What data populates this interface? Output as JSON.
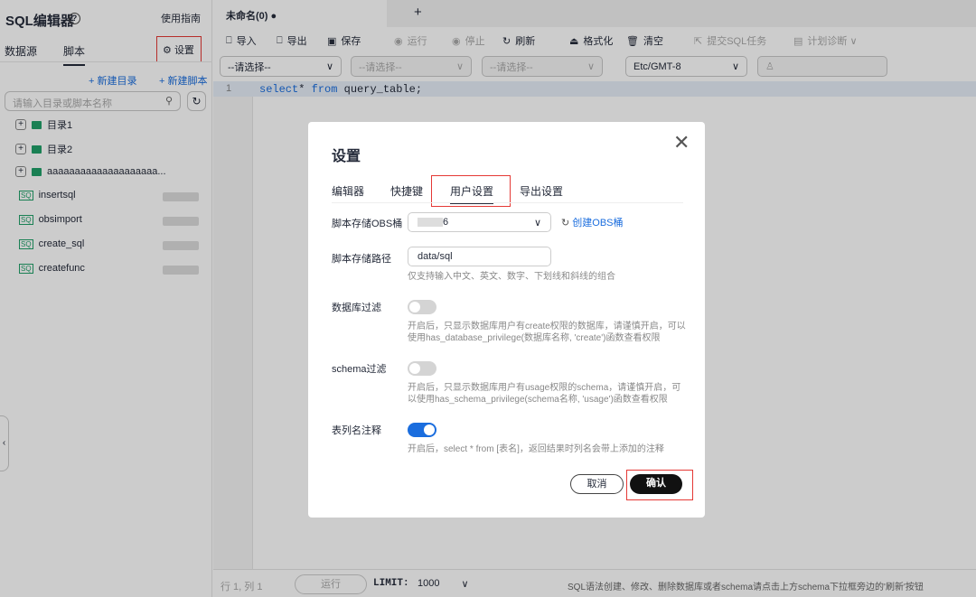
{
  "sidebar": {
    "title": "SQL编辑器",
    "guide": "使用指南",
    "tabs": [
      "数据源",
      "脚本"
    ],
    "settings": "设置",
    "new_dir": "+ 新建目录",
    "new_script": "+ 新建脚本",
    "search_placeholder": "请输入目录或脚本名称",
    "folders": [
      "目录1",
      "目录2",
      "aaaaaaaaaaaaaaaaaaaa..."
    ],
    "scripts": [
      "insertsql",
      "obsimport",
      "create_sql",
      "createfunc"
    ]
  },
  "editor": {
    "tab": "未命名(0) ●",
    "add": "+",
    "toolbar": [
      "导入",
      "导出",
      "保存",
      "运行",
      "停止",
      "刷新",
      "格式化",
      "清空",
      "提交SQL任务",
      "计划诊断 ∨"
    ],
    "selects": [
      "--请选择--",
      "--请选择--",
      "--请选择--",
      "Etc/GMT-8"
    ],
    "line": "1",
    "code_kw1": "select",
    "code_mid": "* ",
    "code_kw2": "from",
    "code_rest": " query_table;"
  },
  "status": {
    "pos": "行 1, 列 1",
    "run": "运行",
    "limit_label": "LIMIT:",
    "limit": "1000",
    "hint": "SQL语法创建、修改、删除数据库或者schema请点击上方schema下拉框旁边的'刷新'按钮"
  },
  "dialog": {
    "title": "设置",
    "tabs": [
      "编辑器",
      "快捷键",
      "用户设置",
      "导出设置"
    ],
    "active_tab": "用户设置",
    "obs_label": "脚本存储OBS桶",
    "obs_value": "6",
    "create_obs": "创建OBS桶",
    "path_label": "脚本存储路径",
    "path_value": "data/sql",
    "path_hint": "仅支持输入中文、英文、数字、下划线和斜线的组合",
    "db_label": "数据库过滤",
    "db_on": false,
    "db_hint": "开启后，只显示数据库用户有create权限的数据库，请谨慎开启，可以使用has_database_privilege(数据库名称, 'create')函数查看权限",
    "schema_label": "schema过滤",
    "schema_on": false,
    "schema_hint": "开启后，只显示数据库用户有usage权限的schema，请谨慎开启，可以使用has_schema_privilege(schema名称, 'usage')函数查看权限",
    "col_label": "表列名注释",
    "col_on": true,
    "col_hint": "开启后，select * from [表名]，返回结果时列名会带上添加的注释",
    "cancel": "取消",
    "confirm": "确认"
  },
  "colors": {
    "accent": "#1a6dde",
    "highlight": "#e53935",
    "folder": "#21a06a"
  }
}
